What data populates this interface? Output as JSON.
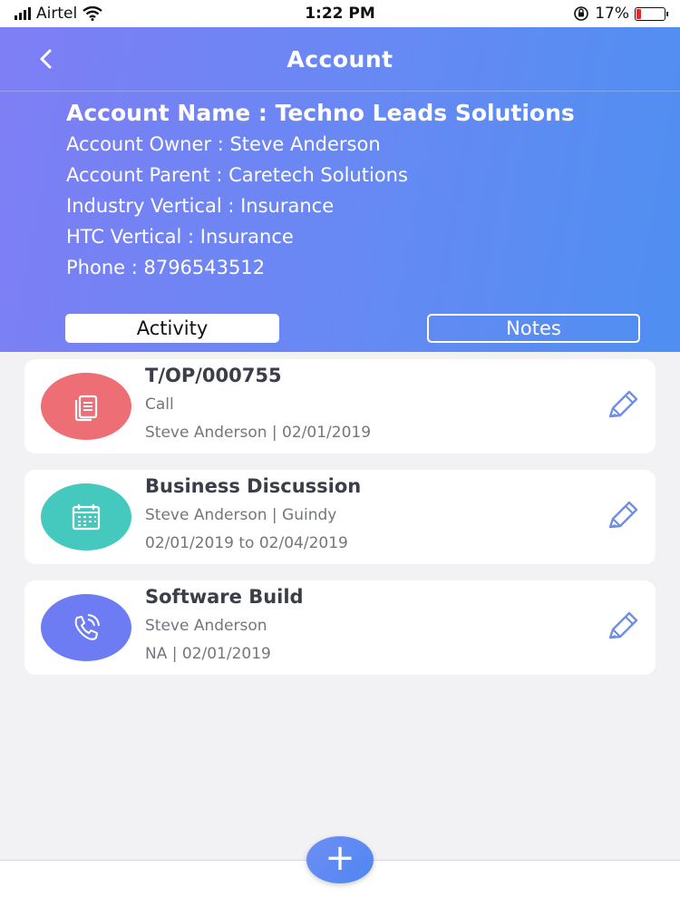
{
  "status_bar": {
    "carrier": "Airtel",
    "time": "1:22 PM",
    "battery": "17%",
    "battery_level": 0.17
  },
  "header": {
    "title": "Account"
  },
  "account": {
    "name": "Account Name : Techno Leads Solutions",
    "owner": "Account Owner : Steve Anderson",
    "parent": "Account Parent : Caretech Solutions",
    "industry": "Industry Vertical : Insurance",
    "htc": "HTC Vertical : Insurance",
    "phone": "Phone : 8796543512"
  },
  "tabs": {
    "activity": "Activity",
    "notes": "Notes"
  },
  "activities": [
    {
      "title": "T/OP/000755",
      "subtitle": "Call",
      "meta": "Steve Anderson | 02/01/2019",
      "icon": "document-icon",
      "color": "#ee6e76"
    },
    {
      "title": "Business Discussion",
      "subtitle": "Steve Anderson | Guindy",
      "meta": "02/01/2019 to 02/04/2019",
      "icon": "calendar-icon",
      "color": "#45c9bf"
    },
    {
      "title": "Software Build",
      "subtitle": "Steve Anderson",
      "meta": "NA | 02/01/2019",
      "icon": "phone-icon",
      "color": "#6d7cf3"
    }
  ],
  "fab": {
    "label": "+"
  },
  "colors": {
    "header_start": "#7f7ef5",
    "header_end": "#4f8ff1",
    "edit_icon": "#6f8fe6"
  }
}
